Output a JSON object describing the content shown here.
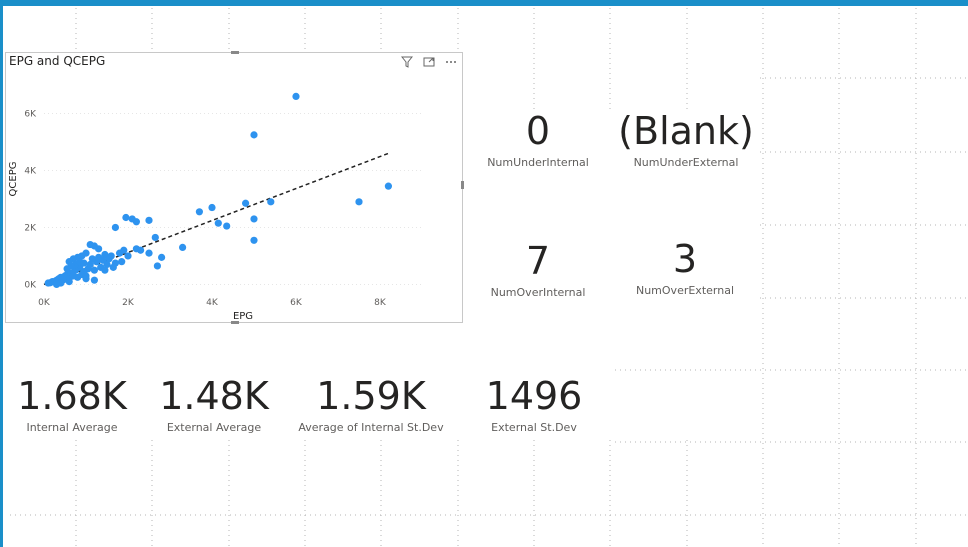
{
  "colors": {
    "accent": "#1a8fc9",
    "point": "#2e93ef",
    "text": "#252423",
    "label": "#605e5c"
  },
  "chart": {
    "title": "EPG and QCEPG",
    "icons": [
      "filter-icon",
      "focus-mode-icon",
      "more-options-icon"
    ]
  },
  "chart_data": {
    "type": "scatter",
    "title": "EPG and QCEPG",
    "xlabel": "EPG",
    "ylabel": "QCEPG",
    "xlim": [
      0,
      9000
    ],
    "ylim": [
      -300,
      7000
    ],
    "xticks": [
      0,
      2000,
      4000,
      6000,
      8000
    ],
    "xtick_labels": [
      "0K",
      "2K",
      "4K",
      "6K",
      "8K"
    ],
    "yticks": [
      0,
      2000,
      4000,
      6000
    ],
    "ytick_labels": [
      "0K",
      "2K",
      "4K",
      "6K"
    ],
    "trendline": {
      "x": [
        0,
        8200
      ],
      "y": [
        0,
        4600
      ],
      "style": "dashed"
    },
    "points": [
      [
        6000,
        6600
      ],
      [
        5000,
        5250
      ],
      [
        8200,
        3450
      ],
      [
        7500,
        2900
      ],
      [
        5400,
        2900
      ],
      [
        4800,
        2850
      ],
      [
        3700,
        2550
      ],
      [
        4000,
        2700
      ],
      [
        5000,
        2300
      ],
      [
        4150,
        2150
      ],
      [
        4350,
        2050
      ],
      [
        5000,
        1550
      ],
      [
        3300,
        1300
      ],
      [
        2500,
        2250
      ],
      [
        2100,
        2300
      ],
      [
        1950,
        2350
      ],
      [
        2200,
        2200
      ],
      [
        1700,
        2000
      ],
      [
        2650,
        1650
      ],
      [
        2500,
        1100
      ],
      [
        2800,
        950
      ],
      [
        2700,
        650
      ],
      [
        2200,
        1250
      ],
      [
        1900,
        1200
      ],
      [
        1800,
        1100
      ],
      [
        1600,
        1000
      ],
      [
        1450,
        1050
      ],
      [
        1300,
        1250
      ],
      [
        1100,
        1400
      ],
      [
        1200,
        1350
      ],
      [
        1000,
        1100
      ],
      [
        900,
        1000
      ],
      [
        800,
        950
      ],
      [
        700,
        900
      ],
      [
        600,
        800
      ],
      [
        1500,
        700
      ],
      [
        1700,
        750
      ],
      [
        1350,
        600
      ],
      [
        1200,
        500
      ],
      [
        1050,
        550
      ],
      [
        950,
        450
      ],
      [
        850,
        600
      ],
      [
        750,
        500
      ],
      [
        650,
        400
      ],
      [
        550,
        350
      ],
      [
        500,
        300
      ],
      [
        400,
        250
      ],
      [
        350,
        200
      ],
      [
        300,
        150
      ],
      [
        250,
        100
      ],
      [
        200,
        100
      ],
      [
        150,
        60
      ],
      [
        100,
        50
      ],
      [
        450,
        150
      ],
      [
        600,
        200
      ],
      [
        700,
        300
      ],
      [
        800,
        250
      ],
      [
        900,
        350
      ],
      [
        1000,
        300
      ],
      [
        1100,
        700
      ],
      [
        1250,
        800
      ],
      [
        1400,
        850
      ],
      [
        1550,
        900
      ],
      [
        1650,
        600
      ],
      [
        1850,
        800
      ],
      [
        2000,
        1000
      ],
      [
        2300,
        1200
      ],
      [
        1000,
        200
      ],
      [
        1200,
        150
      ],
      [
        600,
        100
      ],
      [
        400,
        50
      ],
      [
        300,
        0
      ],
      [
        750,
        700
      ],
      [
        850,
        800
      ],
      [
        950,
        750
      ],
      [
        1150,
        900
      ],
      [
        1300,
        950
      ],
      [
        650,
        650
      ],
      [
        550,
        550
      ],
      [
        1450,
        500
      ]
    ]
  },
  "cards": [
    {
      "value": "0",
      "label": "NumUnderInternal"
    },
    {
      "value": "(Blank)",
      "label": "NumUnderExternal"
    },
    {
      "value": "7",
      "label": "NumOverInternal"
    },
    {
      "value": "3",
      "label": "NumOverExternal"
    },
    {
      "value": "1.68K",
      "label": "Internal Average"
    },
    {
      "value": "1.48K",
      "label": "External Average"
    },
    {
      "value": "1.59K",
      "label": "Average of Internal St.Dev"
    },
    {
      "value": "1496",
      "label": "External St.Dev"
    }
  ]
}
